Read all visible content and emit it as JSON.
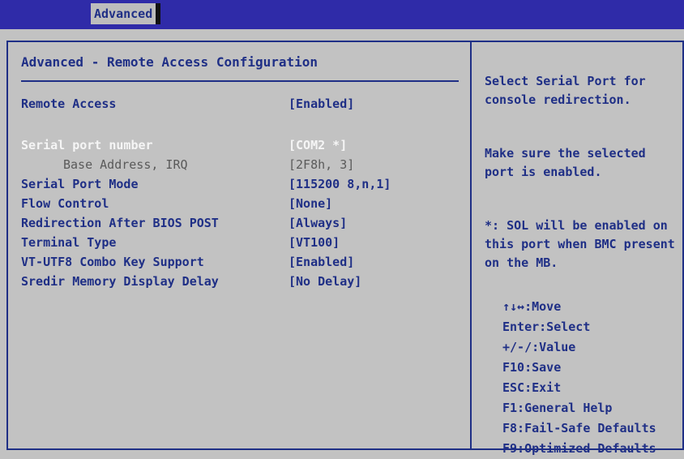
{
  "topbar": {
    "active_tab": "Advanced"
  },
  "main": {
    "title": "Advanced - Remote Access Configuration",
    "items": [
      {
        "label": "Remote Access",
        "value": "[Enabled]"
      },
      {
        "label": "Serial port number",
        "value": "[COM2 *]"
      },
      {
        "label": "Base Address, IRQ",
        "value": "[2F8h, 3]"
      },
      {
        "label": "Serial Port Mode",
        "value": "[115200 8,n,1]"
      },
      {
        "label": "Flow Control",
        "value": "[None]"
      },
      {
        "label": "Redirection After BIOS POST",
        "value": "[Always]"
      },
      {
        "label": "Terminal Type",
        "value": "[VT100]"
      },
      {
        "label": "VT-UTF8 Combo Key Support",
        "value": "[Enabled]"
      },
      {
        "label": "Sredir Memory Display Delay",
        "value": "[No Delay]"
      }
    ]
  },
  "help": {
    "p1": "Select Serial Port for console redirection.",
    "p2": "Make sure the selected port is enabled.",
    "p3": "*: SOL will be enabled on this port when BMC present on the MB."
  },
  "keys": [
    "↑↓↔:Move",
    "Enter:Select",
    "+/-/:Value",
    "F10:Save",
    "ESC:Exit",
    "F1:General Help",
    "F8:Fail-Safe Defaults",
    "F9:Optimized Defaults"
  ]
}
